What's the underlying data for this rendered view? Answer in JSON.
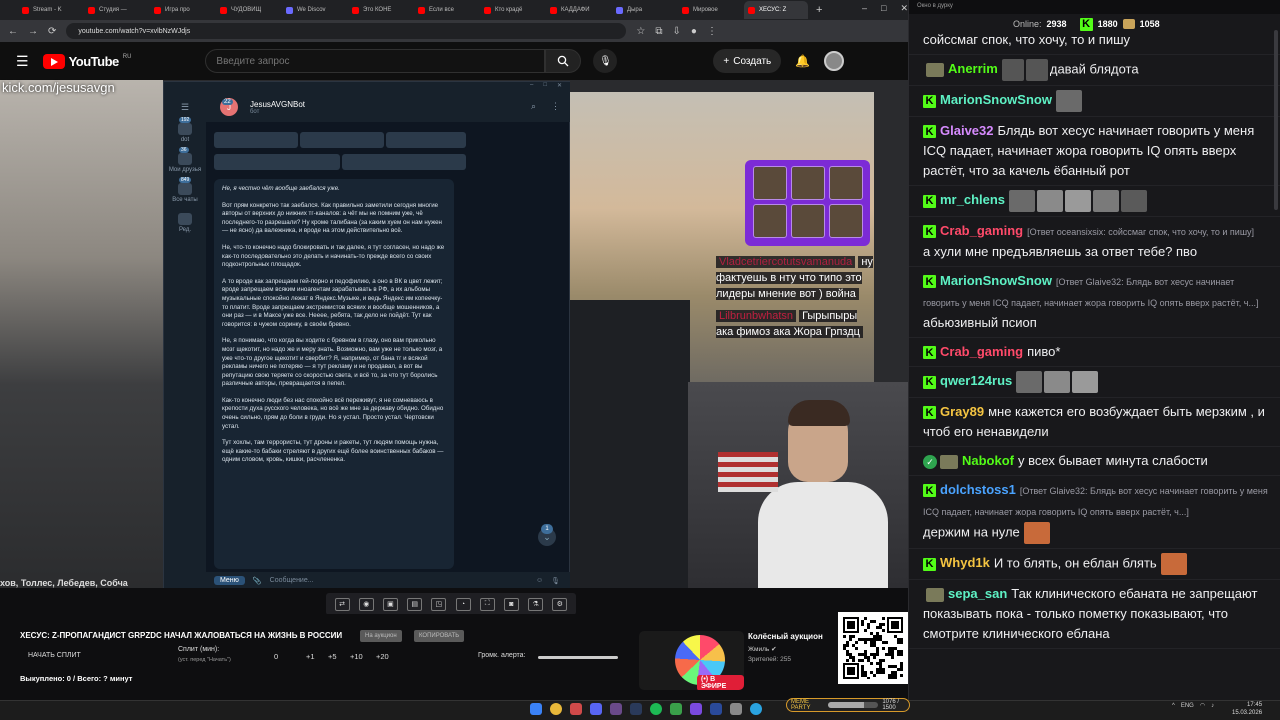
{
  "browser": {
    "tabs": [
      {
        "label": "Stream - K",
        "active": false
      },
      {
        "label": "Студия —",
        "active": false
      },
      {
        "label": "Игра про",
        "active": false
      },
      {
        "label": "ЧУДОВИЩ",
        "active": false
      },
      {
        "label": "We Discov",
        "active": false
      },
      {
        "label": "Это КОНЕ",
        "active": false
      },
      {
        "label": "Если все",
        "active": false
      },
      {
        "label": "Кто крадё",
        "active": false
      },
      {
        "label": "КАДДАФИ",
        "active": false
      },
      {
        "label": "Дыра",
        "active": false
      },
      {
        "label": "Мировое",
        "active": false
      },
      {
        "label": "ХЕСУС: Z",
        "active": true
      }
    ],
    "new_tab": "+",
    "url": "youtube.com/watch?v=xvlbNzWJdjs"
  },
  "youtube": {
    "logo_text": "YouTube",
    "region": "RU",
    "search_placeholder": "Введите запрос",
    "create_label": "Создать"
  },
  "video": {
    "watermark": "kick.com/jesusavgn",
    "ticker": "хов, Толлес, Лебедев, Собча"
  },
  "telegram": {
    "bot_name": "JesusAVGNBot",
    "bot_status": "бот",
    "header_badge": "22",
    "sidebar": [
      {
        "label": "dot",
        "badge": "192"
      },
      {
        "label": "Мои друзья",
        "badge": "36"
      },
      {
        "label": "Все чаты",
        "badge": "849"
      },
      {
        "label": "Ред.",
        "badge": ""
      }
    ],
    "message_paragraphs": [
      "Не, я честно чёт вообще заебался уже.",
      "Вот прям конкретно так заебался. Как правильно заметили сегодня многие авторы от верхних до нижних тг-каналов: а чёт мы не помним уже, чё последнего-то разрешали? Ну кроме талибана (за каким хуем он нам нужен — не ясно) да валежника, и вроде на этом действительно всё.",
      "Не, что-то конечно надо блокировать и так далее, я тут согласен, но надо же как-то последовательно это делать и начинать-то прежде всего со своих подконтрольных площадок.",
      "А то вроде как запрещаем гей-порно и педофилию, а оно в ВК в цвет лежит; вроде запрещаем всяким иноагентам зарабатывать в РФ, а их альбомы музыкальные спокойно лежат в Яндекс.Музыке, и ведь Яндекс им копеечку-то платит. Вроде запрещаем экстремистов всяких и вообще мошенников, а они раз — и в Максе уже все. Нееее, ребята, так дело не пойдёт. Тут как говорится: в чужом соринку, в своём бревно.",
      "Не, я понимаю, что когда вы ходите с бревном в глазу, оно вам прикольно мозг щекотит, но надо же и меру знать. Возможно, вам уже не только мозг, а уже что-то другое щекотит и свербит? Я, например, от бана тг и всякой рекламы ничего не потеряю — я тут рекламу и не продавал, а вот вы репутацию свою теряете со скоростью света, и всё то, за что тут боролись различные авторы, превращается в пепел.",
      "Как-то конечно люди без нас спокойно всё переживут, я не сомневаюсь в крепости духа русского человека, но всё же мне за державу обидно. Обидно очень сильно, прям до боли в груди. Но я устал. Просто устал. Чертовски устал.",
      "Тут хохлы, там террористы, тут дроны и ракеты, тут людям помощь нужна, ещё какие-то бабаки стреляют в других ещё более воинственных бабаков — одним словом, кровь, кишки, расчлененка."
    ],
    "menu_label": "Меню",
    "input_placeholder": "Сообщение...",
    "unread": "1"
  },
  "overlay_chat": [
    {
      "name": "Vladcetriercotutsvamanuda",
      "text": "ну фактуешь в нту что типо это лидеры мнение вот ) война"
    },
    {
      "name": "Lilbrunbwhatsn",
      "text": "Гырыпыры ака фимоз ака Жора Грпздц"
    }
  ],
  "auction": {
    "title": "ХЕСУС: Z-ПРОПАГАНДИСТ GRPZDC НАЧАЛ ЖАЛОВАТЬСЯ НА ЖИЗНЬ В РОССИИ",
    "pill_1": "На аукцион",
    "pill_2": "КОПИРОВАТЬ",
    "start_split": "НАЧАТЬ СПЛИТ",
    "split_label": "Сплит (мин):",
    "split_note": "(уст. перед \"Начать\")",
    "split_values": [
      "0",
      "+1",
      "+5",
      "+10",
      "+20"
    ],
    "volume_label": "Громк. алерта:",
    "bought": "Выкуплено: 0 / Всего: ? минут",
    "preview_title": "Колёсный аукцион",
    "preview_channel": "Жмиль",
    "preview_viewers": "Зрителей: 255",
    "live_badge": "В ЭФИРЕ"
  },
  "taskbar": {
    "lang": "ENG",
    "time": "17:45",
    "date": "15.03.2026",
    "meme_label": "MEME PARTY",
    "meme_count": "1076 / 1500",
    "meme_progress": 0.72
  },
  "chat": {
    "window_title": "Окно в дурку",
    "online_label": "Online:",
    "online": "2938",
    "stat_1": "1880",
    "stat_2": "1058",
    "messages": [
      {
        "name": "",
        "color": "#efeff1",
        "reply": "",
        "text": "сойссмаг спок, что хочу, то и пишу",
        "emotes": 0,
        "avatar": false,
        "kick": false
      },
      {
        "name": "Anerrim",
        "color": "#53fc18",
        "reply": "",
        "text": "давай блядота",
        "emotes": 2,
        "avatar": true,
        "kick": false
      },
      {
        "name": "MarionSnowSnow",
        "color": "#5ef1c4",
        "reply": "",
        "text": "",
        "emotes": 1,
        "avatar": false,
        "kick": true
      },
      {
        "name": "Glaive32",
        "color": "#d78bff",
        "reply": "",
        "text": "Блядь вот хесус начинает говорить у меня ICQ падает, начинает жора говорить IQ опять вверх растёт, что за качель ёбанный рот",
        "emotes": 0,
        "avatar": false,
        "kick": true
      },
      {
        "name": "mr_chlens",
        "color": "#5ef1c4",
        "reply": "",
        "text": "",
        "emotes": 5,
        "avatar": false,
        "kick": true
      },
      {
        "name": "Crab_gaming",
        "color": "#ff4a6a",
        "reply": "[Ответ oceansixsix: сойссмаг спок, что хочу, то и пишу]",
        "text": "а хули мне предъявляешь за ответ тебе? пво",
        "emotes": 0,
        "avatar": false,
        "kick": true
      },
      {
        "name": "MarionSnowSnow",
        "color": "#5ef1c4",
        "reply": "[Ответ Glaive32: Блядь вот хесус начинает говорить у меня ICQ падает, начинает жора говорить IQ опять вверх растёт, ч...]",
        "text": "абьюзивный псиоп",
        "emotes": 0,
        "avatar": false,
        "kick": true
      },
      {
        "name": "Crab_gaming",
        "color": "#ff4a6a",
        "reply": "",
        "text": "пиво*",
        "emotes": 0,
        "avatar": false,
        "kick": true
      },
      {
        "name": "qwer124rus",
        "color": "#5ef1c4",
        "reply": "",
        "text": "",
        "emotes": 3,
        "avatar": false,
        "kick": true
      },
      {
        "name": "Gray89",
        "color": "#f5c542",
        "reply": "",
        "text": "мне кажется его возбуждает быть мерзким , и чтоб его ненавидели",
        "emotes": 0,
        "avatar": false,
        "kick": true
      },
      {
        "name": "Nabokof",
        "color": "#53fc18",
        "reply": "",
        "text": "у всех бывает минута слабости",
        "emotes": 0,
        "avatar": true,
        "kick": false,
        "check": true
      },
      {
        "name": "dolchstoss1",
        "color": "#4aa3ff",
        "reply": "[Ответ Glaive32: Блядь вот хесус начинает говорить у меня ICQ падает, начинает жора говорить IQ опять вверх растёт, ч...]",
        "text": "держим на нуле",
        "emotes": 1,
        "avatar": false,
        "kick": true
      },
      {
        "name": "Whyd1k",
        "color": "#f5c542",
        "reply": "",
        "text": "И то блять, он еблан блять",
        "emotes": 1,
        "avatar": false,
        "kick": true
      },
      {
        "name": "sepa_san",
        "color": "#5ef1c4",
        "reply": "",
        "text": "Так клинического ебаната не запрещают показывать пока - только пометку показывают, что смотрите клинического еблана",
        "emotes": 0,
        "avatar": true,
        "kick": false
      }
    ]
  }
}
